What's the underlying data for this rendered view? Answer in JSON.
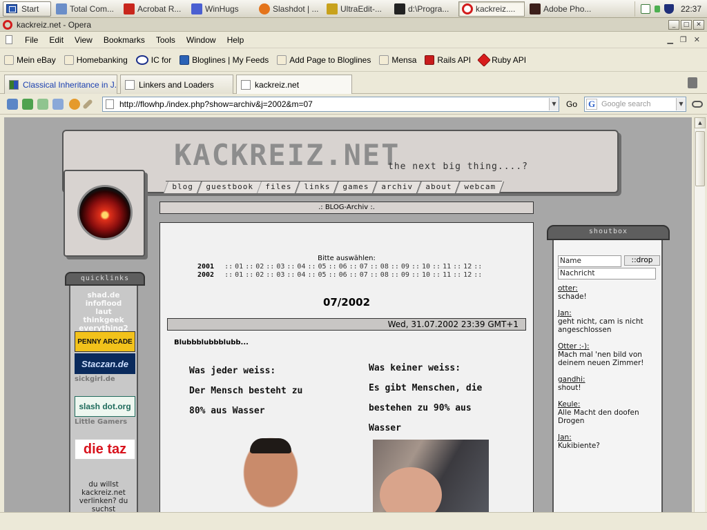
{
  "taskbar": {
    "start_label": "Start",
    "items": [
      {
        "label": "Total Com...",
        "color": "#6b8ec8",
        "active": false
      },
      {
        "label": "Acrobat R...",
        "color": "#c8261c",
        "active": false
      },
      {
        "label": "WinHugs",
        "color": "#4a5fd1",
        "active": false
      },
      {
        "label": "Slashdot | ...",
        "color": "#e4741b",
        "active": false
      },
      {
        "label": "UltraEdit-...",
        "color": "#c8a21c",
        "active": false
      },
      {
        "label": "d:\\Progra...",
        "color": "#222222",
        "active": false
      },
      {
        "label": "kackreiz....",
        "color": "#d21c1c",
        "active": true
      },
      {
        "label": "Adobe Pho...",
        "color": "#3c1f1a",
        "active": false
      }
    ],
    "clock": "22:37"
  },
  "window": {
    "title": "kackreiz.net - Opera"
  },
  "menu": [
    "File",
    "Edit",
    "View",
    "Bookmarks",
    "Tools",
    "Window",
    "Help"
  ],
  "bookmarks": [
    {
      "label": "Mein eBay",
      "icon": "page-icon"
    },
    {
      "label": "Homebanking",
      "icon": "page-icon"
    },
    {
      "label": "IC for",
      "icon": "ic-icon"
    },
    {
      "label": "Bloglines | My Feeds",
      "icon": "bloglines-icon"
    },
    {
      "label": "Add Page to Bloglines",
      "icon": "page-icon"
    },
    {
      "label": "Mensa",
      "icon": "page-icon"
    },
    {
      "label": "Rails API",
      "icon": "rails-icon"
    },
    {
      "label": "Ruby API",
      "icon": "ruby-icon"
    }
  ],
  "tabs": [
    {
      "label": "Classical Inheritance in J...",
      "active": false
    },
    {
      "label": "Linkers and Loaders",
      "active": false
    },
    {
      "label": "kackreiz.net",
      "active": true
    }
  ],
  "address": {
    "url": "http://flowhp./index.php?show=archiv&j=2002&m=07",
    "go_label": "Go",
    "search_placeholder": "Google search"
  },
  "site": {
    "logo": "KACKREIZ.NET",
    "tagline": "the next big thing....?",
    "nav": [
      "blog",
      "guestbook",
      "files",
      "links",
      "games",
      "archiv",
      "about",
      "webcam"
    ],
    "archive_title": ".: BLOG-Archiv :.",
    "pick_label": "Bitte auswählen:",
    "years": [
      {
        "year": "2001",
        "months": [
          "01",
          "02",
          "03",
          "04",
          "05",
          "06",
          "07",
          "08",
          "09",
          "10",
          "11",
          "12"
        ]
      },
      {
        "year": "2002",
        "months": [
          "01",
          "02",
          "03",
          "04",
          "05",
          "06",
          "07",
          "08",
          "09",
          "10",
          "11",
          "12"
        ]
      }
    ],
    "month_title": "07/2002",
    "post_date": "Wed, 31.07.2002 23:39 GMT+1",
    "post_title": "Blubbblubbblubb...",
    "left_text": [
      "Was jeder weiss:",
      "Der Mensch besteht zu",
      "80% aus Wasser"
    ],
    "right_text": [
      "Was keiner weiss:",
      "Es gibt Menschen, die",
      "bestehen zu 90% aus",
      "Wasser"
    ]
  },
  "quicklinks": {
    "title": "quicklinks",
    "links": [
      "shad.de",
      "infoflood",
      "laut",
      "thinkgeek",
      "everything2"
    ],
    "banners": [
      "PENNY ARCADE",
      "Staczan.de",
      "slash dot.org",
      "die taz"
    ],
    "small_labels": [
      "sickgirl.de",
      "Little Gamers"
    ],
    "footer": [
      "du willst",
      "kackreiz.net",
      "verlinken? du",
      "suchst"
    ]
  },
  "shoutbox": {
    "title": "shoutbox",
    "name_value": "Name",
    "message_value": "Nachricht",
    "button_label": "::drop",
    "shouts": [
      {
        "name": "otter",
        "text": "schade!"
      },
      {
        "name": "Jan",
        "text": "geht nicht, cam is nicht angeschlossen"
      },
      {
        "name": "Otter :-)",
        "text": "Mach mal 'nen bild von deinem neuen Zimmer!"
      },
      {
        "name": "gandhi",
        "text": "shout!"
      },
      {
        "name": "Keule",
        "text": "Alle Macht den doofen Drogen"
      },
      {
        "name": "Jan",
        "text": "Kukibiente?"
      }
    ]
  }
}
